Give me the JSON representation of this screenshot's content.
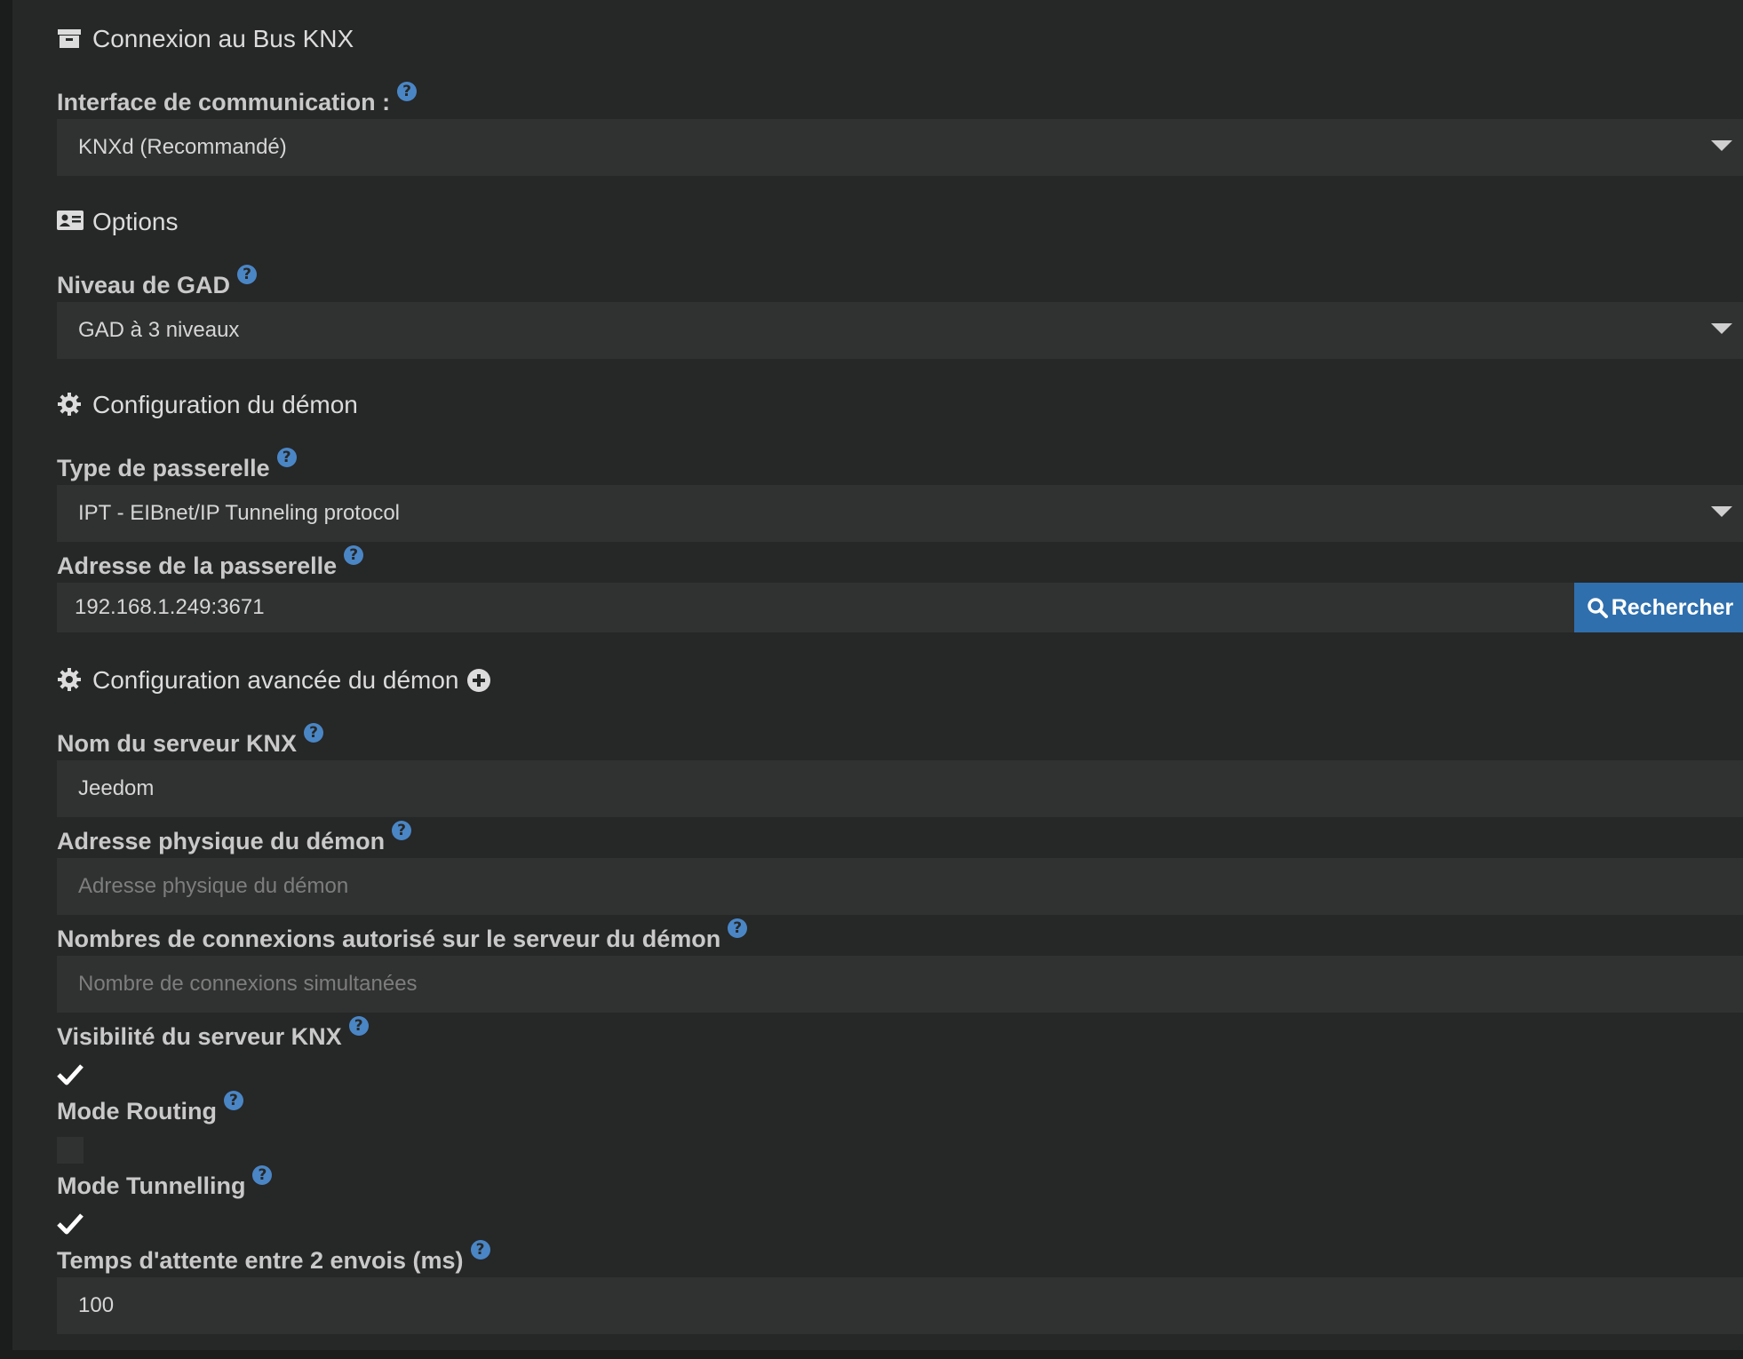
{
  "sections": {
    "bus": "Connexion au Bus KNX",
    "options": "Options",
    "daemon": "Configuration du démon",
    "advanced": "Configuration avancée du démon"
  },
  "fields": {
    "interface": {
      "label": "Interface de communication :",
      "value": "KNXd (Recommandé)"
    },
    "gad_level": {
      "label": "Niveau de GAD",
      "value": "GAD à 3 niveaux"
    },
    "gateway_type": {
      "label": "Type de passerelle",
      "value": "IPT - EIBnet/IP Tunneling protocol"
    },
    "gateway_address": {
      "label": "Adresse de la passerelle",
      "value": "192.168.1.249:3671",
      "button": "Rechercher"
    },
    "server_name": {
      "label": "Nom du serveur KNX",
      "value": "Jeedom"
    },
    "physical_address": {
      "label": "Adresse physique du démon",
      "placeholder": "Adresse physique du démon"
    },
    "connections": {
      "label": "Nombres de connexions autorisé sur le serveur du démon",
      "placeholder": "Nombre de connexions simultanées"
    },
    "visibility": {
      "label": "Visibilité du serveur KNX",
      "checked": true
    },
    "routing": {
      "label": "Mode Routing",
      "checked": false
    },
    "tunnelling": {
      "label": "Mode Tunnelling",
      "checked": true
    },
    "wait_time": {
      "label": "Temps d'attente entre 2 envois (ms)",
      "value": "100"
    }
  },
  "help_glyph": "?",
  "colors": {
    "accent": "#2f6fad",
    "help": "#4a86c5",
    "panel": "#262727",
    "input": "#303131"
  }
}
